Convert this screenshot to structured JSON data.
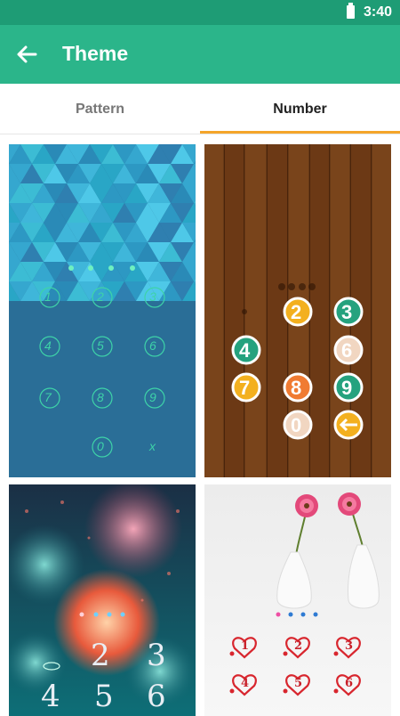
{
  "status_bar": {
    "time": "3:40",
    "battery_icon": "battery-icon"
  },
  "app_bar": {
    "title": "Theme",
    "back_icon": "arrow-back-icon"
  },
  "tabs": [
    {
      "label": "Pattern",
      "selected": false
    },
    {
      "label": "Number",
      "selected": true
    }
  ],
  "colors": {
    "status_bar": "#1e9c75",
    "app_bar": "#2bb58a",
    "tab_indicator": "#f4a52b"
  },
  "themes": [
    {
      "keys": [
        "1",
        "2",
        "3",
        "4",
        "5",
        "6",
        "7",
        "8",
        "9",
        "0",
        "x"
      ]
    },
    {
      "keys": [
        "2",
        "3",
        "4",
        "6",
        "7",
        "8",
        "9",
        "0"
      ]
    },
    {
      "keys": [
        "2",
        "3",
        "4",
        "5",
        "6"
      ]
    },
    {
      "keys": [
        "1",
        "2",
        "3",
        "4",
        "5",
        "6"
      ]
    }
  ]
}
